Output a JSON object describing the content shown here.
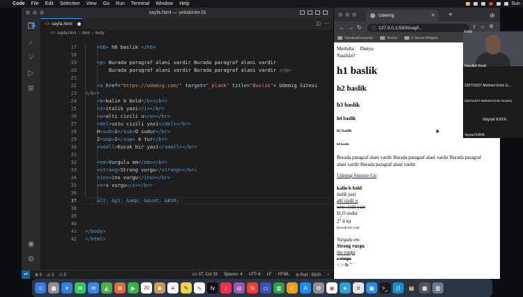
{
  "menubar": {
    "app": "Code",
    "items": [
      "File",
      "Edit",
      "Selection",
      "View",
      "Go",
      "Run",
      "Terminal",
      "Window",
      "Help"
    ],
    "clock": "Sun"
  },
  "vscode": {
    "title": "sayfa.html — yetiskinlerJS",
    "tab_label": "sayfa.html",
    "breadcrumb": [
      "sayfa.html",
      "html",
      "body"
    ],
    "line_numbers": [
      "17",
      "18",
      "19",
      "20",
      "21",
      "22",
      "23",
      "24",
      "25",
      "26",
      "27",
      "28",
      "29",
      "30",
      "31",
      "32",
      "33",
      "34",
      "35",
      "36",
      "37",
      "38",
      "39",
      "40",
      "41",
      "42"
    ],
    "current_line": "37",
    "code": {
      "l17": [
        "<h6>",
        " h6 baslik ",
        "</h6>"
      ],
      "l19": [
        "<p>",
        " Burada paragraf alani vardir Burada paragraf alani vardir"
      ],
      "l20": "Burada paragraf alani vardir Burada paragraf alani vardir ",
      "l20_close": "</p>",
      "l22_open": "<a ",
      "l22_href_attr": "href",
      "l22_href_val": "\"https://udemig.com/\"",
      "l22_target_attr": " target",
      "l22_target_val": "\"_blank\"",
      "l22_title_attr": " title",
      "l22_title_val": "\"Baslik\"",
      "l22_text": "> Udemig Sitesi",
      "l23": "</br>",
      "l24": [
        "<b>",
        "kalin b bold",
        "</b>",
        "</br>"
      ],
      "l25": [
        "<i>",
        "italik yazi",
        "</i>",
        "</br>"
      ],
      "l26": [
        "<u>",
        "alti cizili u",
        "</u>",
        "</br>"
      ],
      "l27": [
        "<del>",
        "ustu cizili yazi",
        "</del>",
        "</br>"
      ],
      "l28": [
        "H",
        "<sub>",
        "2",
        "</sub>",
        "O sudur",
        "</br>"
      ],
      "l29": [
        "2",
        "<sup>",
        "2",
        "</sup>",
        " 4 tur",
        "</br>"
      ],
      "l30": [
        "<small>",
        "Kucuk bir yazi",
        "</small>",
        "</br>"
      ],
      "l32": [
        "<em>",
        "Vurgulu em",
        "</em>",
        "</br>"
      ],
      "l33": [
        "<strong>",
        "Strong vurgu",
        "</strong>",
        "</br>"
      ],
      "l34": [
        "<ins>",
        "ins vurgu",
        "</ins>",
        "</br>"
      ],
      "l35": [
        "<s>",
        "s vurgu",
        "</s>",
        "</br>"
      ],
      "l37": "&lt; &gt; &amp; &quot; &#39;",
      "l41": "</body>",
      "l42": "</html>"
    },
    "status": {
      "errors": "0",
      "warnings": "0",
      "live": "0",
      "position": "Ln 37, Col 33",
      "spaces": "Spaces: 4",
      "encoding": "UTF-8",
      "eol": "LF",
      "language": "HTML",
      "port": "Port : 5500"
    }
  },
  "browser": {
    "tab_title": "Udemig",
    "url": "127.0.0.1:5500/sayf...",
    "bookmarks": [
      "NordeaAccounts",
      "Tester",
      "6.SezonYetişkin"
    ],
    "page": {
      "intro_line1": "Merhaba     Dunya",
      "intro_line2": "Nasilsin?",
      "h1": "h1 baslik",
      "h2": "h2 baslik",
      "h3": "h3 baslik",
      "h4": "h4 baslik",
      "h5": "h5 baslik",
      "h6": "h6 baslik",
      "paragraph_line1": "Burada paragraf alani vardir Burada paragraf alani vardir Burada paragraf",
      "paragraph_line2": "alani vardir Burada paragraf alani vardir",
      "link": "Udemig Sitesine Git",
      "bold": "kalin b bold",
      "italic": "italik yazi",
      "underline": "alti cizili u",
      "strike": "ustu cizili yazi",
      "water_h": "H",
      "water_sub": "2",
      "water_rest": "O sudur",
      "pow_base": "2",
      "pow_sup": "2",
      "pow_rest": " 4 tur",
      "small": "Kucuk bir yazi",
      "em": "Vurgulu em",
      "strong": "Strong vurgu",
      "ins": "ins vurgu",
      "s": "s vurgu",
      "entities": "< > & \" '"
    }
  },
  "video": {
    "participant_top": "Fahri",
    "participant_main": "Nurullah Bedir",
    "tile_2": "220721027 Mehmet Emin G...",
    "tile_3": "220721027 Mehmet Emin Güvenç",
    "tile_4": "Veysel KAYA",
    "tile_5": "Veysel KAYA"
  },
  "dock": {
    "calendar_day": "20"
  },
  "colors": {
    "accent": "#3e8ff0",
    "tag": "#569cd6",
    "attribute": "#9cdcfe",
    "string": "#ce9178",
    "link": "#0000ee"
  }
}
